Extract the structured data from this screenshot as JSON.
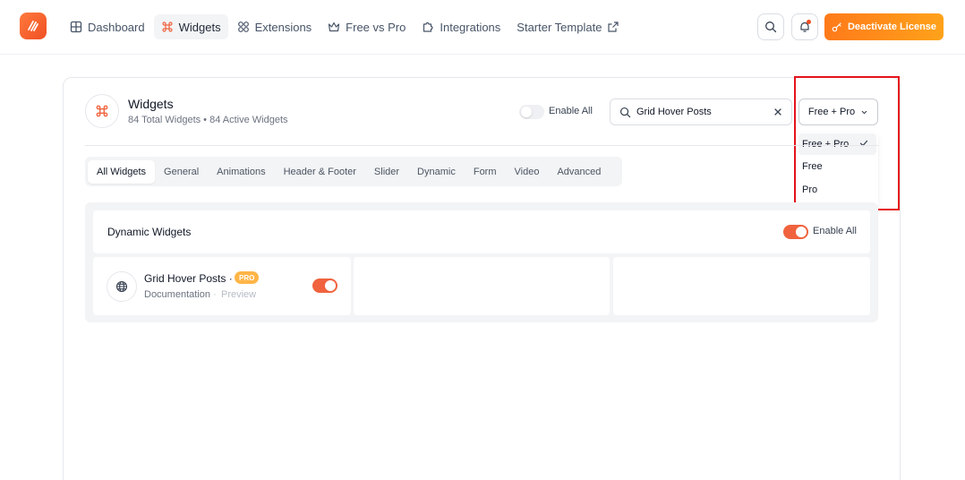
{
  "nav": {
    "items": [
      {
        "label": "Dashboard",
        "icon": "grid-icon",
        "active": false
      },
      {
        "label": "Widgets",
        "icon": "command-icon",
        "active": true
      },
      {
        "label": "Extensions",
        "icon": "extensions-icon",
        "active": false
      },
      {
        "label": "Free vs Pro",
        "icon": "crown-icon",
        "active": false
      },
      {
        "label": "Integrations",
        "icon": "puzzle-icon",
        "active": false
      },
      {
        "label": "Starter Template",
        "icon": "external-link-icon",
        "active": false
      }
    ],
    "license_button": "Deactivate License"
  },
  "header": {
    "title": "Widgets",
    "subtitle": "84 Total Widgets • 84 Active Widgets",
    "enable_all": "Enable All"
  },
  "search": {
    "value": "Grid Hover Posts"
  },
  "filter": {
    "selected": "Free + Pro",
    "options": [
      "Free + Pro",
      "Free",
      "Pro"
    ]
  },
  "tabs": [
    "All Widgets",
    "General",
    "Animations",
    "Header & Footer",
    "Slider",
    "Dynamic",
    "Form",
    "Video",
    "Advanced"
  ],
  "section": {
    "title": "Dynamic Widgets",
    "enable_all": "Enable All",
    "widget": {
      "name": "Grid Hover Posts ·",
      "badge": "PRO",
      "doc": "Documentation",
      "sep": "·",
      "preview": "Preview",
      "enabled": true
    }
  },
  "colors": {
    "accent": "#f0633e",
    "license": "#ff8a1a",
    "highlight": "#e4131b"
  }
}
